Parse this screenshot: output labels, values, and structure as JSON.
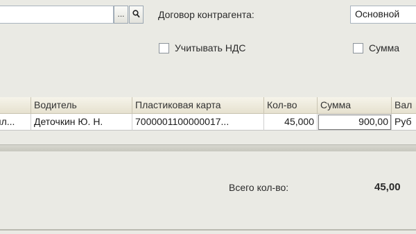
{
  "form": {
    "ellipsis_label": "...",
    "contract_label": "Договор контрагента:",
    "contract_value": "Основной",
    "vat_checkbox_label": "Учитывать НДС",
    "sum_checkbox_label": "Сумма"
  },
  "table": {
    "columns": [
      "",
      "Водитель",
      "Пластиковая карта",
      "Кол-во",
      "Сумма",
      "Вал"
    ],
    "rows": [
      {
        "col0": "пл...",
        "driver": "Деточкин Ю. Н.",
        "card": "7000001100000017...",
        "qty": "45,000",
        "sum": "900,00",
        "currency": "Руб"
      }
    ]
  },
  "totals": {
    "qty_label": "Всего кол-во:",
    "qty_value": "45,00"
  }
}
